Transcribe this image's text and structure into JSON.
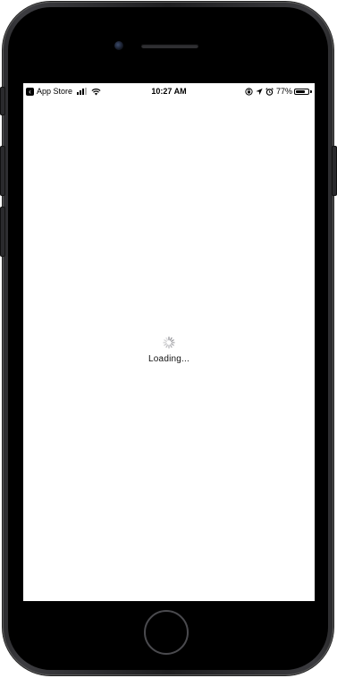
{
  "status_bar": {
    "back_app": "App Store",
    "time": "10:27 AM",
    "battery_percent": "77%",
    "battery_level": 0.77,
    "signal_bars_filled": 3,
    "signal_bars_total": 4,
    "icons": [
      "back-arrow-icon",
      "cellular-signal-icon",
      "wifi-icon",
      "orientation-lock-icon",
      "location-arrow-icon",
      "alarm-icon",
      "battery-icon"
    ]
  },
  "content": {
    "loading_text": "Loading..."
  },
  "colors": {
    "device_frame": "#2b2b2e",
    "screen_background": "#ffffff",
    "text": "#000000",
    "spinner": "#8e8e93"
  }
}
